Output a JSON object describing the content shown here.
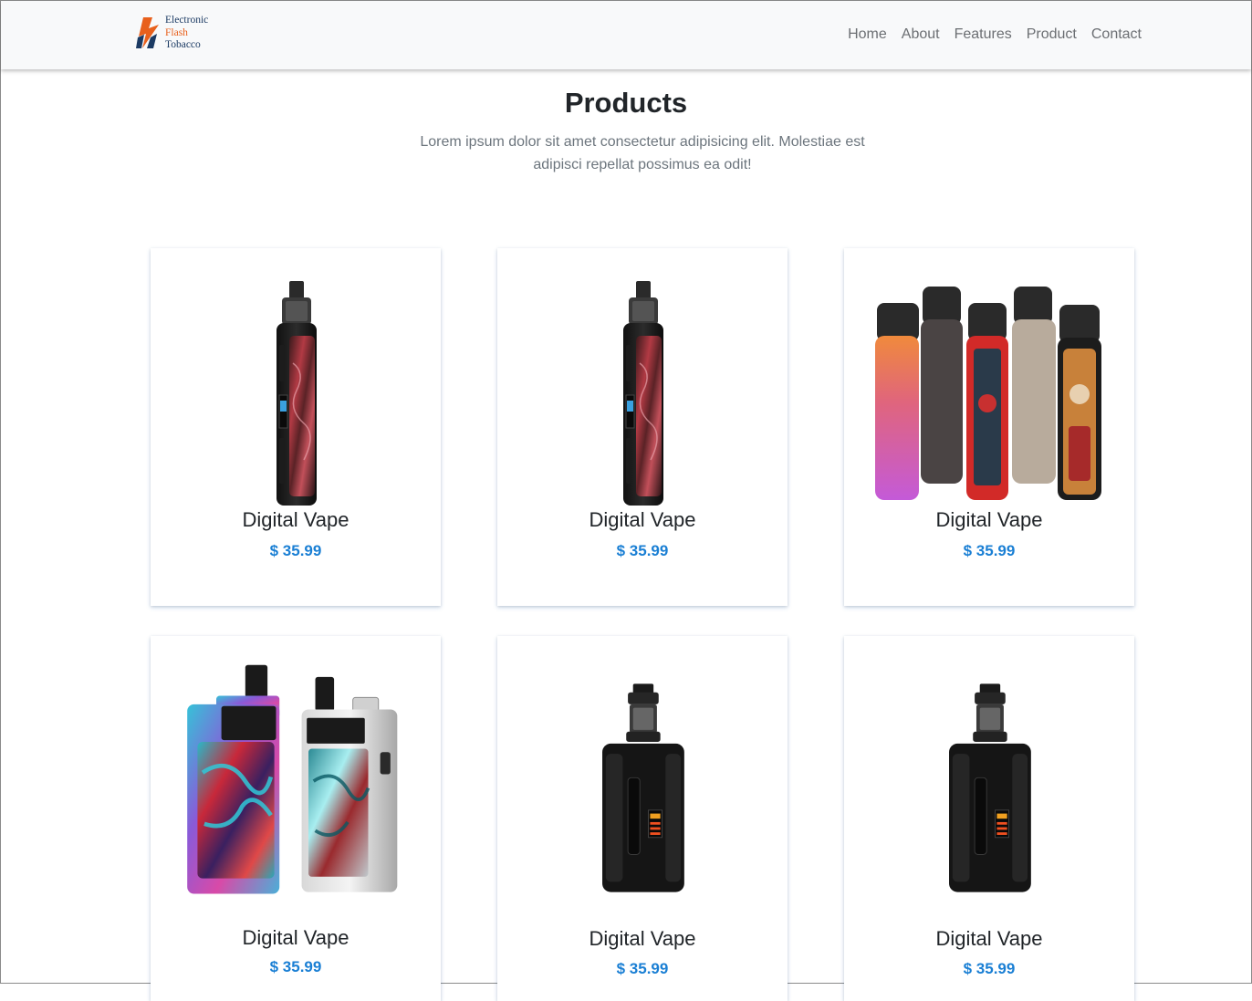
{
  "brand": {
    "line1": "Electronic",
    "line2": "Flash",
    "line3": "Tobacco",
    "colors": {
      "navy": "#1b3a63",
      "orange": "#e8601c"
    }
  },
  "nav": [
    "Home",
    "About",
    "Features",
    "Product",
    "Contact"
  ],
  "section": {
    "title": "Products",
    "subtitle": "Lorem ipsum dolor sit amet consectetur adipisicing elit. Molestiae est adipisci repellat possimus ea odit!"
  },
  "products": [
    {
      "name": "Digital Vape",
      "price": "$ 35.99",
      "image": "pod-mod-red-swirl-icon"
    },
    {
      "name": "Digital Vape",
      "price": "$ 35.99",
      "image": "pod-mod-red-swirl-icon"
    },
    {
      "name": "Digital Vape",
      "price": "$ 35.99",
      "image": "pod-pen-collection-icon"
    },
    {
      "name": "Digital Vape",
      "price": "$ 35.99",
      "image": "resin-pod-pair-icon"
    },
    {
      "name": "Digital Vape",
      "price": "$ 35.99",
      "image": "box-mod-black-icon"
    },
    {
      "name": "Digital Vape",
      "price": "$ 35.99",
      "image": "box-mod-black-icon"
    }
  ],
  "colors": {
    "accent": "#1a7fd4",
    "navbar_bg": "#f8f9fa",
    "muted": "#6c757d"
  }
}
